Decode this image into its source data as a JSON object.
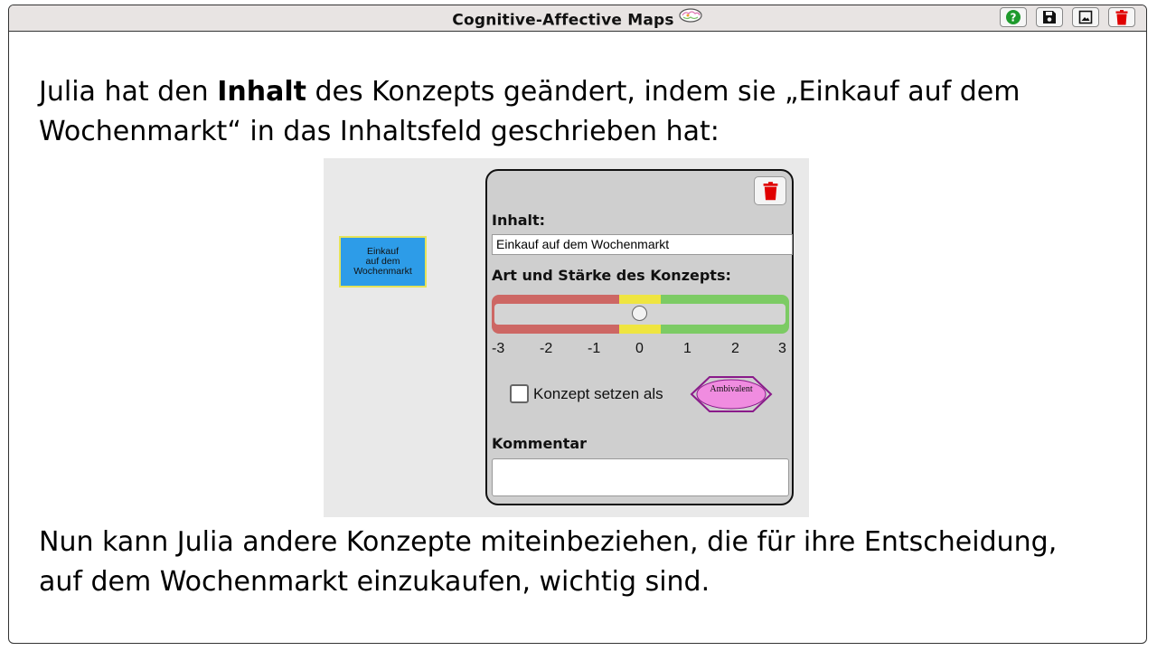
{
  "window": {
    "title": "Cognitive-Affective Maps",
    "title_icon": "brain-icon",
    "buttons": [
      {
        "name": "help-button",
        "icon": "question-circle-icon",
        "color": "#1e9a2c"
      },
      {
        "name": "save-button",
        "icon": "floppy-disk-icon",
        "color": "#111111"
      },
      {
        "name": "image-button",
        "icon": "image-icon",
        "color": "#111111"
      },
      {
        "name": "delete-button",
        "icon": "trash-icon",
        "color": "#e00000"
      }
    ]
  },
  "paragraph1": {
    "part1": "Julia hat den ",
    "bold": "Inhalt",
    "part2": " des Konzepts geändert, indem sie „Einkauf auf dem",
    "line2": "Wochenmarkt“ in das Inhaltsfeld geschrieben hat:"
  },
  "screenshot": {
    "node": {
      "lines": [
        "Einkauf",
        "auf dem",
        "Wochenmarkt"
      ],
      "color": "#2d9ce8",
      "border_color": "#e6e35a"
    },
    "panel": {
      "content_label": "Inhalt:",
      "content_value": "Einkauf auf dem Wochenmarkt",
      "type_label": "Art und Stärke des Konzepts:",
      "slider_ticks": [
        "-3",
        "-2",
        "-1",
        "0",
        "1",
        "2",
        "3"
      ],
      "slider_value": 0,
      "checkbox_label": "Konzept setzen als",
      "checkbox_checked": false,
      "ambivalent_label": "Ambivalent",
      "comment_label": "Kommentar",
      "comment_value": ""
    }
  },
  "paragraph2": {
    "line1": "Nun kann Julia andere Konzepte miteinbeziehen, die für ihre Entscheidung,",
    "line2": "auf dem Wochenmarkt einzukaufen, wichtig sind."
  }
}
